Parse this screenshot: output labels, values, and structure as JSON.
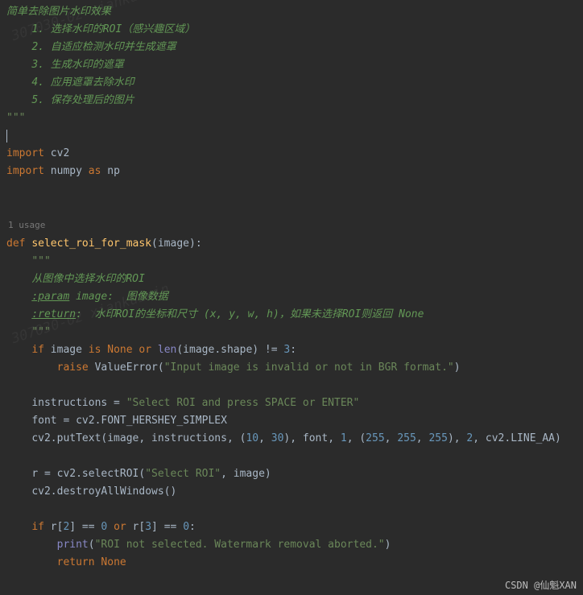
{
  "watermark_text1": "307030-02 xiankuixin",
  "watermark_text2": "307030-02 xiankuixin",
  "csdn_attribution": "CSDN @仙魁XAN",
  "usage_hint": "1 usage",
  "code": {
    "doc_title": "简单去除图片水印效果",
    "steps": [
      "1. 选择水印的ROI（感兴趣区域）",
      "2. 自适应检测水印并生成遮罩",
      "3. 生成水印的遮罩",
      "4. 应用遮罩去除水印",
      "5. 保存处理后的图片"
    ],
    "triple_quote": "\"\"\"",
    "import1_kw": "import",
    "import1_mod": " cv2",
    "import2_kw": "import",
    "import2_mod": " numpy ",
    "import2_as": "as",
    "import2_alias": " np",
    "def_kw": "def",
    "func_name": "select_roi_for_mask",
    "func_sig_open": "(",
    "func_param": "image",
    "func_sig_close": "):",
    "doc_desc": "从图像中选择水印的ROI",
    "param_tag": ":param",
    "param_line": " image:  图像数据",
    "return_tag": ":return",
    "return_line": ":  水印ROI的坐标和尺寸 (x, y, w, h)，如果未选择ROI则返回 None",
    "if_kw": "if",
    "is_kw": "is",
    "none_kw": "None",
    "or_kw": "or",
    "len_fn": "len",
    "shape_check1": " image ",
    "shape_check2": "(image.shape) != ",
    "num3": "3",
    "colon": ":",
    "raise_kw": "raise",
    "valueerror": "ValueError",
    "err_str": "\"Input image is invalid or not in BGR format.\"",
    "close_paren": ")",
    "instr_assign": "instructions = ",
    "instr_str": "\"Select ROI and press SPACE or ENTER\"",
    "font_line": "font = cv2.FONT_HERSHEY_SIMPLEX",
    "puttext_pre": "cv2.putText(image",
    "comma": ", ",
    "puttext_instr": "instructions",
    "open_tuple": "(",
    "num10": "10",
    "num30": "30",
    "close_tuple_comma": "), ",
    "puttext_font": "font",
    "num1": "1",
    "num255": "255",
    "num2": "2",
    "puttext_tail": "cv2.LINE_AA)",
    "selectroi_pre": "r = cv2.selectROI(",
    "selectroi_str": "\"Select ROI\"",
    "selectroi_post": ", image)",
    "destroy_line": "cv2.destroyAllWindows()",
    "r_open1": " r[",
    "r_close_eq": "] == ",
    "num0": "0",
    "print_fn": "print",
    "print_str": "\"ROI not selected. Watermark removal aborted.\"",
    "return_kw": "return",
    "none_lit": "None"
  }
}
